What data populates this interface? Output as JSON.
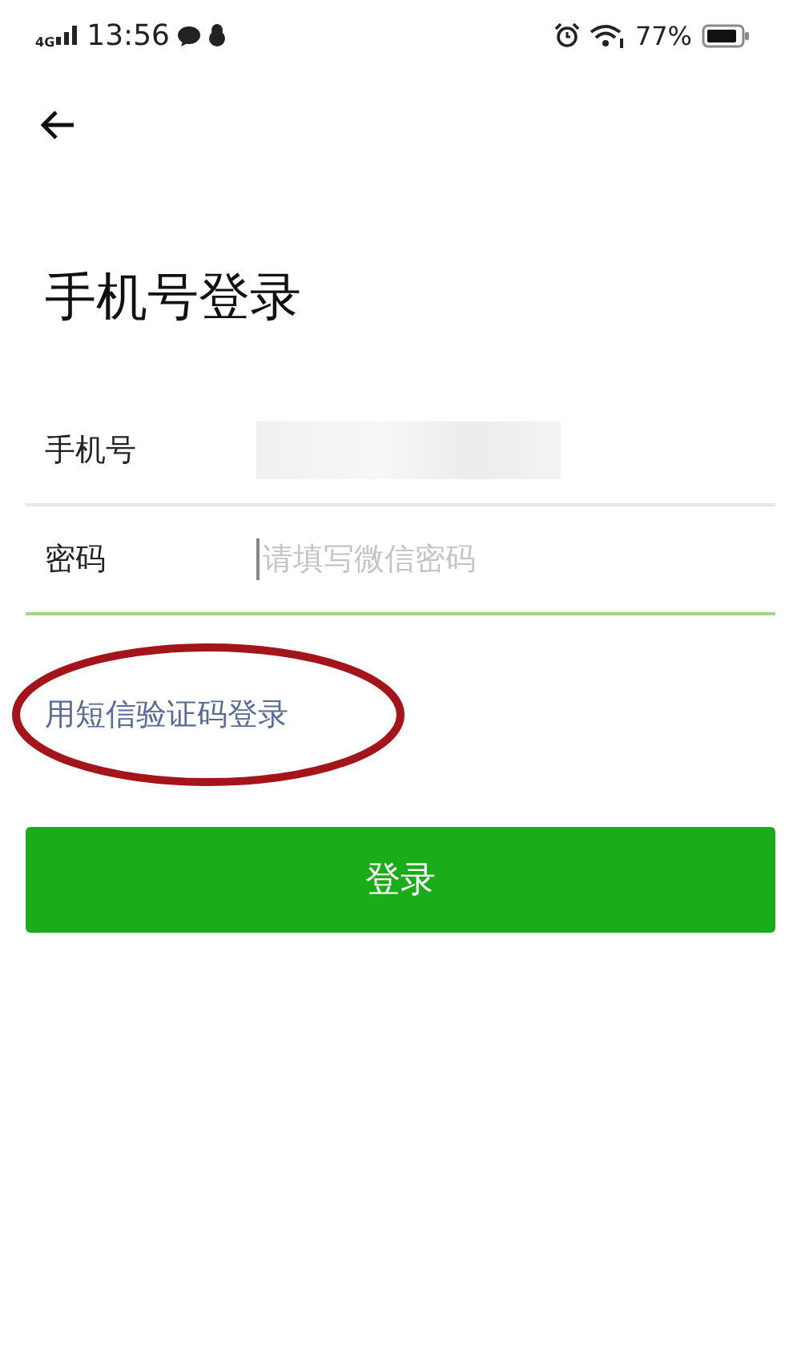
{
  "status_bar": {
    "network": "4G",
    "time": "13:56",
    "battery": "77%"
  },
  "title": "手机号登录",
  "fields": [
    {
      "label": "手机号",
      "kind": "redacted",
      "focused": false
    },
    {
      "label": "密码",
      "kind": "password",
      "placeholder": "请填写微信密码",
      "focused": true
    }
  ],
  "sms_link": "用短信验证码登录",
  "annotation": {
    "kind": "ellipse",
    "color": "#a3151b"
  },
  "login_button": "登录"
}
